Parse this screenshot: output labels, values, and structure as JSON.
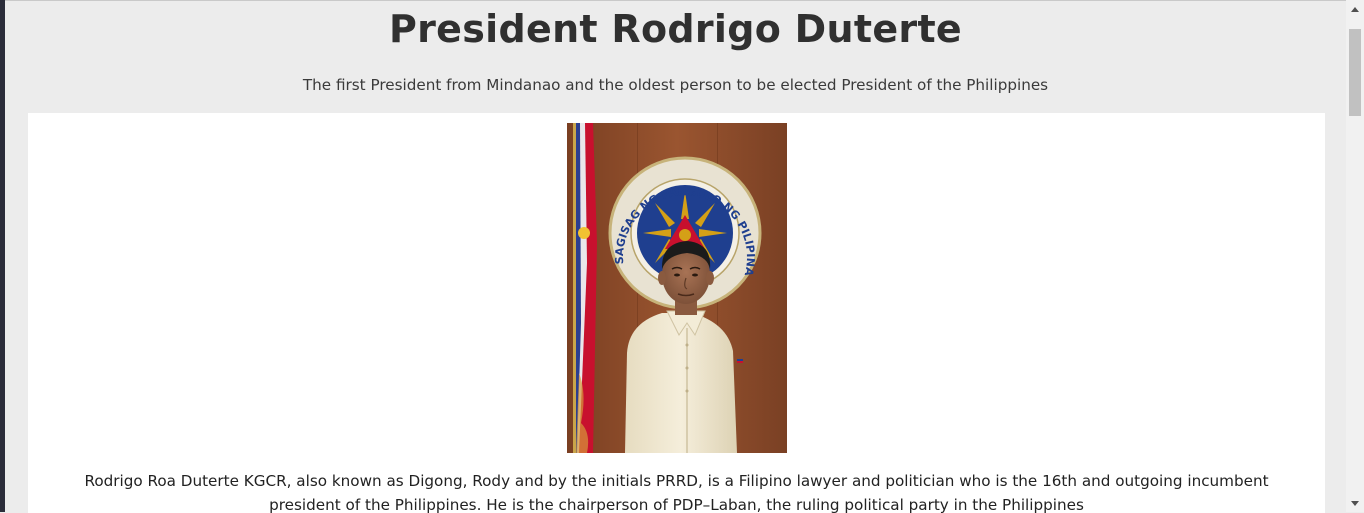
{
  "page": {
    "title": "President Rodrigo Duterte",
    "subtitle": "The first President from Mindanao and the oldest person to be elected President of the Philippines"
  },
  "portrait": {
    "seal_text": "SAGISAG NG PANGULO NG PILIPINAS",
    "colors": {
      "wood_background": "#8a4a2a",
      "barong": "#efe6cf",
      "seal_blue": "#1f3f8f",
      "seal_gold": "#d4a017",
      "flag_red": "#c8102e"
    }
  },
  "bio": {
    "text": "Rodrigo Roa Duterte KGCR, also known as Digong, Rody and by the initials PRRD, is a Filipino lawyer and politician who is the 16th and outgoing incumbent president of the Philippines. He is the chairperson of PDP–Laban, the ruling political party in the Philippines"
  },
  "scrollbar": {
    "up_icon": "chevron-up-icon",
    "down_icon": "chevron-down-icon"
  },
  "colors": {
    "page_background": "#ececec",
    "card_background": "#ffffff",
    "title_text": "#303030"
  }
}
